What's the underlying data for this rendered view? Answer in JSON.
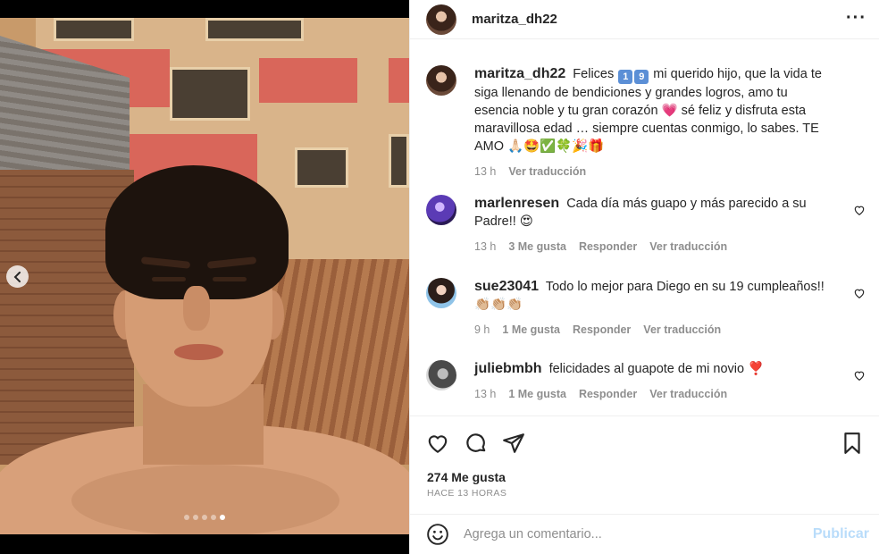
{
  "post": {
    "username": "maritza_dh22",
    "more_icon": "more-horizontal-icon",
    "carousel": {
      "slide_count": 5,
      "active_slide": 5
    }
  },
  "caption": {
    "username": "maritza_dh22",
    "text_before": "Felices",
    "badges": [
      "1",
      "9"
    ],
    "text_after": "mi querido hijo, que la vida te siga llenando de bendiciones y grandes logros, amo tu esencia noble y tu gran corazón 💗 sé feliz y disfruta esta maravillosa edad … siempre cuentas conmigo, lo sabes. TE AMO 🙏🏻🤩✅🍀🎉🎁",
    "time": "13 h",
    "translate": "Ver traducción"
  },
  "comments": [
    {
      "username": "marlenresen",
      "text": "Cada día más guapo y más parecido a su Padre!! 😍",
      "time": "13 h",
      "likes": "3 Me gusta",
      "reply": "Responder",
      "translate": "Ver traducción"
    },
    {
      "username": "sue23041",
      "text": "Todo lo mejor para Diego en su 19 cumpleaños!! 👏🏼👏🏼👏🏼",
      "time": "9 h",
      "likes": "1 Me gusta",
      "reply": "Responder",
      "translate": "Ver traducción"
    },
    {
      "username": "juliebmbh",
      "text": "felicidades al guapote de mi novio ❣️",
      "time": "13 h",
      "likes": "1 Me gusta",
      "reply": "Responder",
      "translate": "Ver traducción"
    }
  ],
  "actions": {
    "icons": [
      "heart-icon",
      "comment-icon",
      "share-icon",
      "bookmark-icon"
    ],
    "likes_count": "274 Me gusta",
    "posted": "HACE 13 HORAS"
  },
  "comment_box": {
    "placeholder": "Agrega un comentario...",
    "publish_label": "Publicar"
  },
  "colors": {
    "link_disabled": "#b9dcfa",
    "muted": "#8e8e8e",
    "text": "#262626"
  }
}
